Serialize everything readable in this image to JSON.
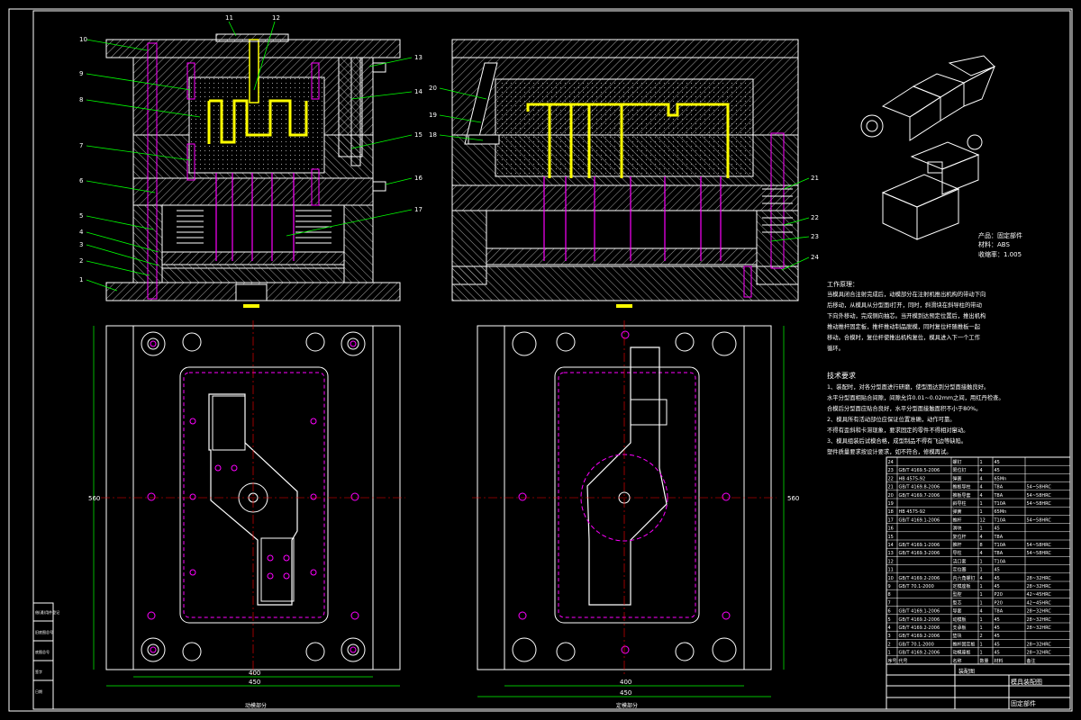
{
  "drawing": {
    "colors": {
      "background": "#000000",
      "outline": "#ffffff",
      "hatch": "#c8c8c8",
      "part": "#ffff00",
      "pin": "#ff00ff",
      "leader": "#00ff00",
      "dimension": "#00ff00",
      "center": "#ff0000",
      "annotation": "#ff00ff"
    },
    "callouts_left": [
      "10",
      "9",
      "8",
      "7",
      "6",
      "5",
      "4",
      "3",
      "2",
      "1"
    ],
    "callouts_top": [
      "11",
      "12"
    ],
    "callouts_right": [
      "13",
      "14",
      "15",
      "16",
      "17"
    ],
    "callouts_mid": [
      "20",
      "19",
      "18"
    ],
    "callouts_far": [
      "21",
      "22",
      "23",
      "24"
    ],
    "product": {
      "name": "产品：固定部件",
      "material": "材料：ABS",
      "shrink": "收缩率：1.005"
    },
    "work_process_title": "工作原理：",
    "work_process": [
      "当模具闭合注射完成后，动模部分在注射机推出机构的带动下向",
      "后移动，从模具从分型面I打开，同时，斜滑块在斜导柱的带动",
      "下向外移动，完成侧向抽芯。当开模到达预定位置后，推出机构",
      "推动推杆固定板，推杆推动制品脱模，同时复位杆随推板一起",
      "移动。合模时，复位杆使推出机构复位，模具进入下一个工作",
      "循环。"
    ],
    "tech_title": "技术要求",
    "tech_requirements": [
      "1、装配时，对各分型面进行研磨，使型面达到分型面接触良好。",
      "水平分型面相贴合间隙，间隙允许0.01~0.02mm之间，用红丹检查。",
      "合模后分型面应贴合良好，水平分型面接触面积不小于80%。",
      "2、模具所有活动部位应保证位置准确，动作可靠。",
      "不得有歪斜和卡滞现象，要求固定的零件不得相对窜动。",
      "3、模具组装后试模合格，成型制品不得有飞边等缺陷。",
      "塑件质量要求按设计要求，如不符合，修模再试。"
    ],
    "bom_rows": [
      [
        "24",
        "",
        "螺钉",
        "1",
        "45",
        ""
      ],
      [
        "23",
        "GB/T 4169.5-2006",
        "限位钉",
        "4",
        "45",
        ""
      ],
      [
        "22",
        "HB 4575-92",
        "弹簧",
        "4",
        "65Mn",
        ""
      ],
      [
        "21",
        "GB/T 4169.8-2006",
        "推板导柱",
        "4",
        "T8A",
        "54~58HRC"
      ],
      [
        "20",
        "GB/T 4169.7-2006",
        "推板导套",
        "4",
        "T8A",
        "54~58HRC"
      ],
      [
        "19",
        "",
        "斜导柱",
        "1",
        "T10A",
        "54~58HRC"
      ],
      [
        "18",
        "HB 4575-92",
        "弹簧",
        "1",
        "65Mn",
        ""
      ],
      [
        "17",
        "GB/T 4169.1-2006",
        "推杆",
        "12",
        "T10A",
        "54~58HRC"
      ],
      [
        "16",
        "",
        "滑块",
        "1",
        "45",
        ""
      ],
      [
        "15",
        "",
        "复位杆",
        "4",
        "T8A",
        ""
      ],
      [
        "14",
        "GB/T 4169.1-2006",
        "推杆",
        "8",
        "T10A",
        "54~58HRC"
      ],
      [
        "13",
        "GB/T 4169.3-2006",
        "导柱",
        "4",
        "T8A",
        "54~58HRC"
      ],
      [
        "12",
        "",
        "浇口套",
        "1",
        "T10A",
        ""
      ],
      [
        "11",
        "",
        "定位圈",
        "1",
        "45",
        ""
      ],
      [
        "10",
        "GB/T 4169.2-2006",
        "内六角螺钉",
        "4",
        "45",
        "28~32HRC"
      ],
      [
        "9",
        "GB/T 70.1-2000",
        "定模座板",
        "1",
        "45",
        "28~32HRC"
      ],
      [
        "8",
        "",
        "型腔",
        "1",
        "P20",
        "42~45HRC"
      ],
      [
        "7",
        "",
        "型芯",
        "1",
        "P20",
        "42~45HRC"
      ],
      [
        "6",
        "GB/T 4169.1-2006",
        "导套",
        "4",
        "T8A",
        "28~32HRC"
      ],
      [
        "5",
        "GB/T 4169.2-2006",
        "动模板",
        "1",
        "45",
        "28~32HRC"
      ],
      [
        "4",
        "GB/T 4169.2-2006",
        "支承板",
        "1",
        "45",
        "28~32HRC"
      ],
      [
        "3",
        "GB/T 4169.2-2006",
        "垫块",
        "2",
        "45",
        ""
      ],
      [
        "2",
        "GB/T 70.1-2000",
        "推杆固定板",
        "1",
        "45",
        "28~32HRC"
      ],
      [
        "1",
        "GB/T 4169.2-2006",
        "动模座板",
        "1",
        "45",
        "28~32HRC"
      ]
    ],
    "bom_header": [
      "序号",
      "代号",
      "名称",
      "数量",
      "材料",
      "备注"
    ],
    "title_block": {
      "title": "固定部件",
      "subtitle": "模具装配图",
      "drawing_no": "装配图"
    },
    "view_labels": {
      "left_plan": "动模部分",
      "right_plan": "定模部分"
    },
    "side_stamp": [
      "借(通)用件登记",
      "旧底图总号",
      "底图总号",
      "签字",
      "日期"
    ],
    "dims": {
      "left_width": "450",
      "left_inner": "400",
      "left_height": "560",
      "right_width": "450",
      "right_inner": "400",
      "right_height": "560"
    }
  }
}
